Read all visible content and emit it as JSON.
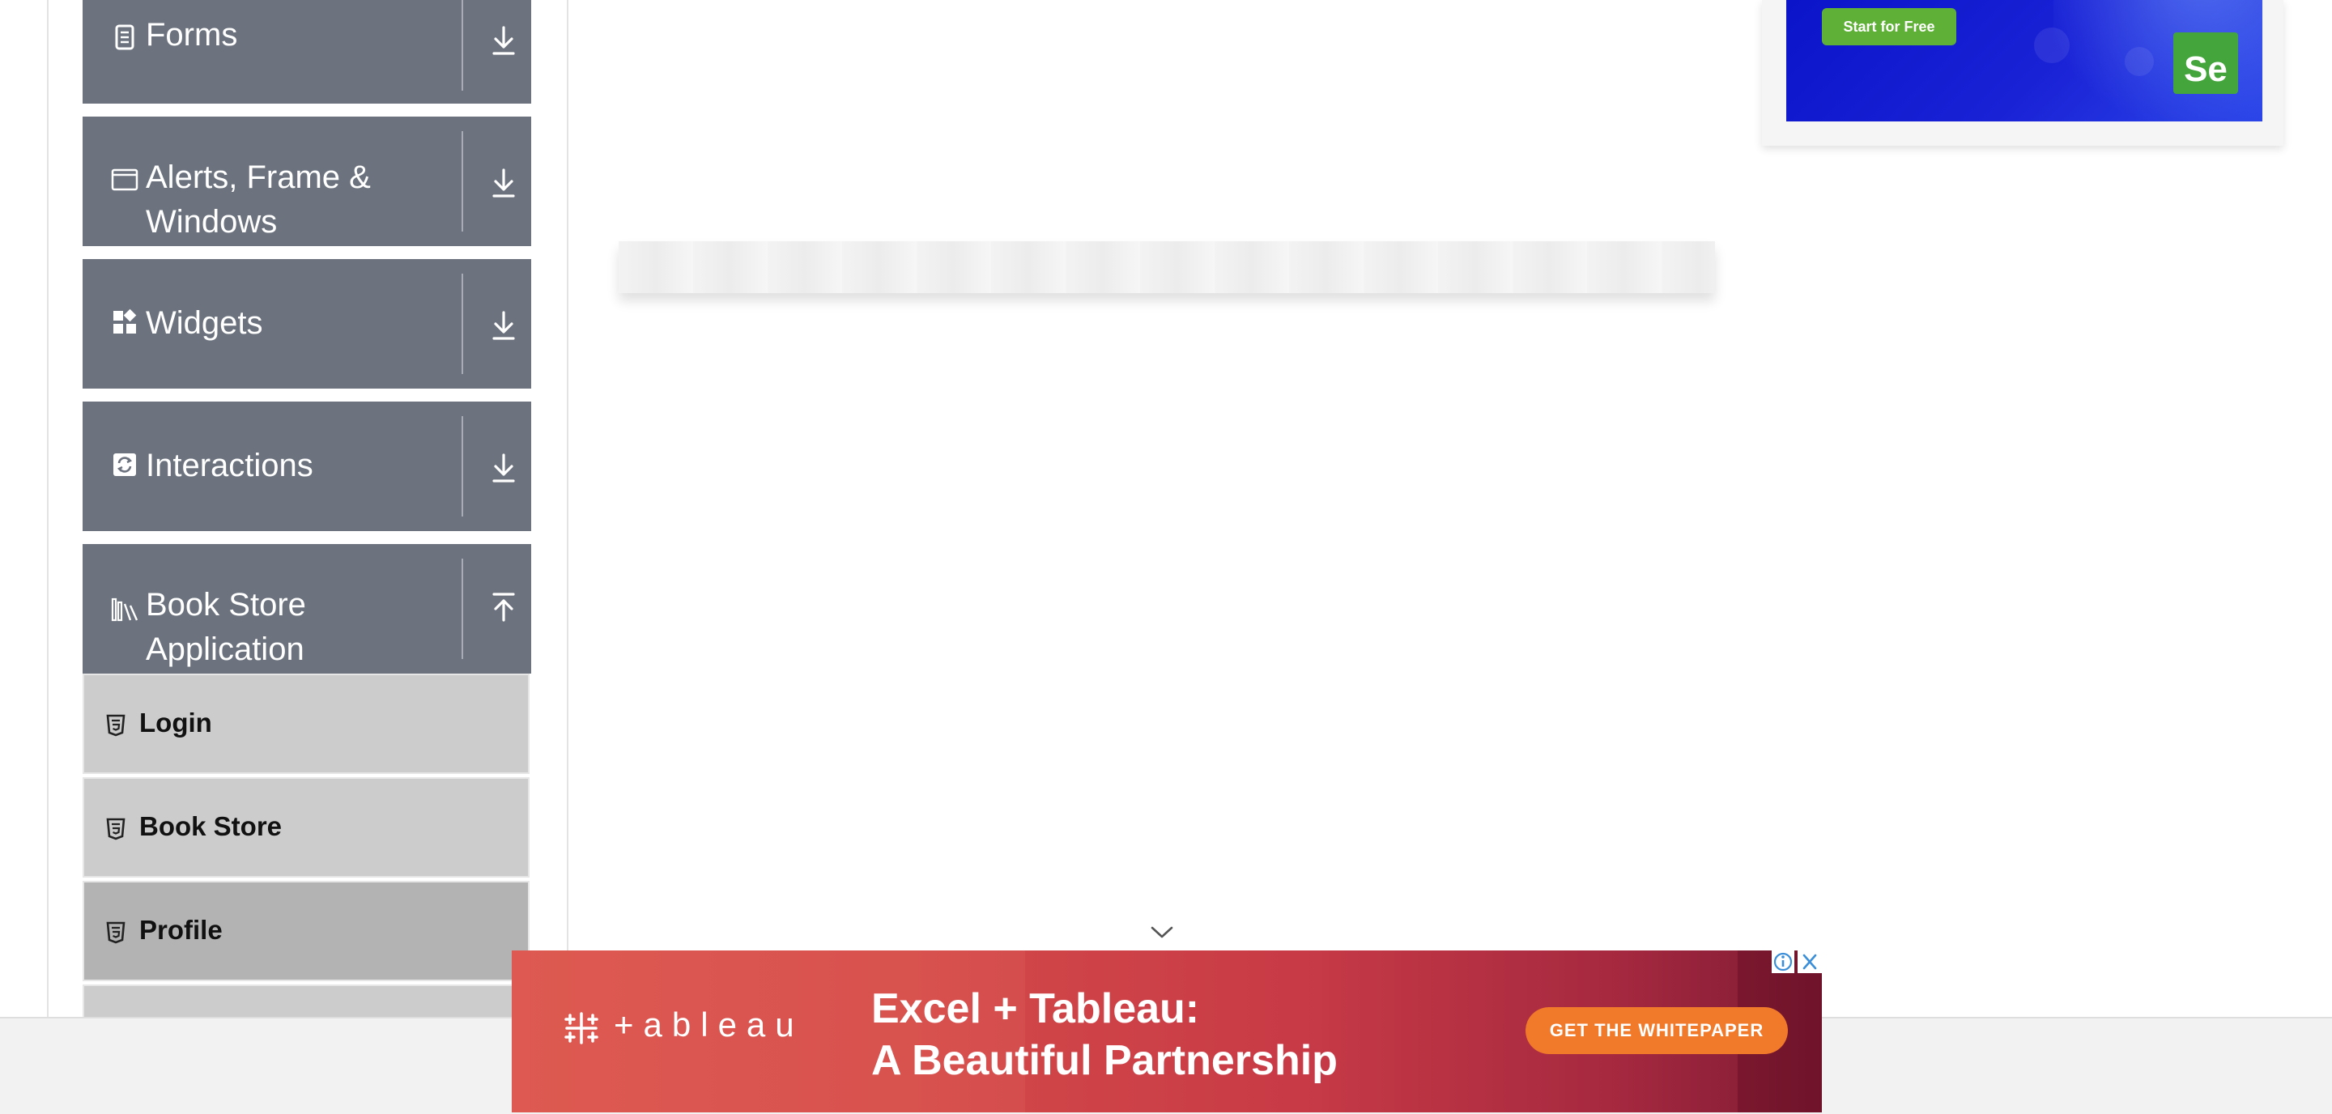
{
  "sidebar": {
    "groups": [
      {
        "label": "Forms",
        "icon": "form-icon",
        "state": "collapsed"
      },
      {
        "label": "Alerts, Frame & Windows",
        "icon": "window-icon",
        "state": "collapsed"
      },
      {
        "label": "Widgets",
        "icon": "widgets-icon",
        "state": "collapsed"
      },
      {
        "label": "Interactions",
        "icon": "interactions-icon",
        "state": "collapsed"
      },
      {
        "label": "Book Store Application",
        "icon": "books-icon",
        "state": "expanded"
      }
    ],
    "book_store_items": [
      {
        "label": "Login",
        "icon": "html5-icon"
      },
      {
        "label": "Book Store",
        "icon": "html5-icon"
      },
      {
        "label": "Profile",
        "icon": "html5-icon",
        "active": true
      }
    ]
  },
  "top_ad": {
    "cta": "Start for Free",
    "logo_text": "Se",
    "colors": {
      "background": "#0b14c9",
      "cta": "#5fb036",
      "logo": "#43a53c"
    }
  },
  "bottom_ad": {
    "brand": "+ableau",
    "headline_line1": "Excel + Tableau:",
    "headline_line2": "A Beautiful Partnership",
    "cta": "GET THE WHITEPAPER",
    "colors": {
      "background": "#d34a48",
      "cta": "#f07a2a"
    }
  },
  "colors": {
    "group_header": "#6c737e",
    "menu_item": "#cccccc",
    "menu_item_active": "#b3b3b3"
  }
}
